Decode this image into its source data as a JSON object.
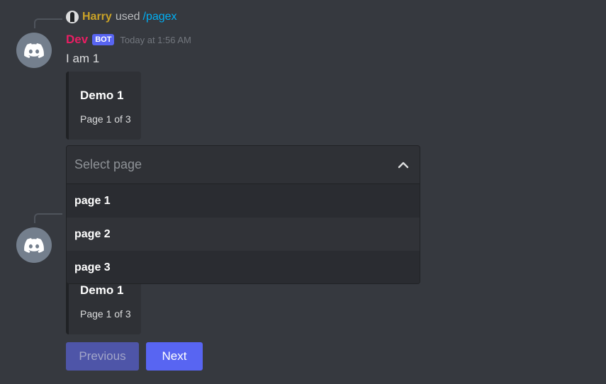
{
  "message1": {
    "reference": {
      "user": "Harry",
      "used_text": "used",
      "command": "/pagex"
    },
    "author": "Dev",
    "bot_tag": "BOT",
    "timestamp": "Today at 1:56 AM",
    "content": "I am 1",
    "embed": {
      "title": "Demo 1",
      "description": "Page 1 of 3"
    }
  },
  "select_menu": {
    "placeholder": "Select page",
    "options": [
      {
        "label": "page 1"
      },
      {
        "label": "page 2"
      },
      {
        "label": "page 3"
      }
    ]
  },
  "message2": {
    "embed": {
      "title": "Demo 1",
      "description": "Page 1 of 3"
    }
  },
  "buttons": {
    "previous": "Previous",
    "next": "Next"
  },
  "colors": {
    "background": "#36393f",
    "blurple": "#5865f2",
    "author": "#e91e63",
    "reply_user": "#c9a227",
    "command": "#00aff4"
  },
  "icons": {
    "avatar": "discord-logo-icon",
    "chevron": "chevron-up-icon"
  }
}
